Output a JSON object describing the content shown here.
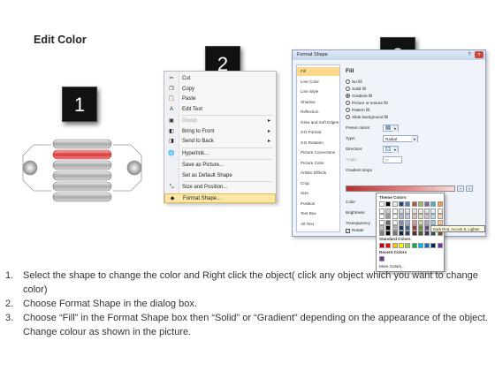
{
  "title": "Edit Color",
  "steps": [
    "1",
    "2",
    "3"
  ],
  "context_menu": {
    "items": [
      {
        "label": "Cut",
        "icon": "scissors-icon",
        "glyph": "✂",
        "disabled": false,
        "submenu": false,
        "highlight": false
      },
      {
        "label": "Copy",
        "icon": "copy-icon",
        "glyph": "❐",
        "disabled": false,
        "submenu": false,
        "highlight": false
      },
      {
        "label": "Paste",
        "icon": "paste-icon",
        "glyph": "📋",
        "disabled": false,
        "submenu": false,
        "highlight": false
      },
      {
        "label": "Edit Text",
        "icon": "edit-text-icon",
        "glyph": "A",
        "disabled": false,
        "submenu": false,
        "highlight": false
      },
      {
        "label": "Group",
        "icon": "group-icon",
        "glyph": "▣",
        "disabled": true,
        "submenu": true,
        "highlight": false
      },
      {
        "label": "Bring to Front",
        "icon": "bring-front-icon",
        "glyph": "◧",
        "disabled": false,
        "submenu": true,
        "highlight": false
      },
      {
        "label": "Send to Back",
        "icon": "send-back-icon",
        "glyph": "◨",
        "disabled": false,
        "submenu": true,
        "highlight": false
      },
      {
        "label": "Hyperlink...",
        "icon": "hyperlink-icon",
        "glyph": "🌐",
        "disabled": false,
        "submenu": false,
        "highlight": false
      },
      {
        "label": "Save as Picture...",
        "icon": "",
        "glyph": "",
        "disabled": false,
        "submenu": false,
        "highlight": false
      },
      {
        "label": "Set as Default Shape",
        "icon": "",
        "glyph": "",
        "disabled": false,
        "submenu": false,
        "highlight": false
      },
      {
        "label": "Size and Position...",
        "icon": "size-position-icon",
        "glyph": "⤡",
        "disabled": false,
        "submenu": false,
        "highlight": false
      },
      {
        "label": "Format Shape...",
        "icon": "format-shape-icon",
        "glyph": "◆",
        "disabled": false,
        "submenu": false,
        "highlight": true
      }
    ]
  },
  "dialog": {
    "title": "Format Shape",
    "title_buttons": [
      "?",
      "×"
    ],
    "nav": [
      "Fill",
      "Line Color",
      "Line Style",
      "Shadow",
      "Reflection",
      "Glow and Soft Edges",
      "3-D Format",
      "3-D Rotation",
      "Picture Corrections",
      "Picture Color",
      "Artistic Effects",
      "Crop",
      "Size",
      "Position",
      "Text Box",
      "Alt Text"
    ],
    "nav_selected": 0,
    "pane_heading": "Fill",
    "fill_options": [
      {
        "label": "No fill",
        "selected": false
      },
      {
        "label": "Solid fill",
        "selected": false
      },
      {
        "label": "Gradient fill",
        "selected": true
      },
      {
        "label": "Picture or texture fill",
        "selected": false
      },
      {
        "label": "Pattern fill",
        "selected": false
      },
      {
        "label": "Slide background fill",
        "selected": false
      }
    ],
    "preset_colors_label": "Preset colors:",
    "type_label": "Type:",
    "type_value": "Radial",
    "direction_label": "Direction:",
    "angle_label": "Angle:",
    "angle_value": "0°",
    "gradient_stops_label": "Gradient stops",
    "color_label": "Color",
    "position_label": "Position:",
    "position_value": "0%",
    "brightness_label": "Brightness",
    "transparency_label": "Transparency",
    "rotate_label": "Rotate"
  },
  "color_popup": {
    "theme_label": "Theme Colors",
    "standard_label": "Standard Colors",
    "recent_label": "Recent Colors",
    "more_label": "More Colors...",
    "tooltip": "Dark Red, Accent 5, Lighter",
    "theme_top": [
      "#ffffff",
      "#000000",
      "#eeece1",
      "#1f497d",
      "#4f81bd",
      "#c0504d",
      "#9bbb59",
      "#8064a2",
      "#4bacc6",
      "#f79646"
    ],
    "standard": [
      "#c00000",
      "#ff0000",
      "#ffc000",
      "#ffff00",
      "#92d050",
      "#00b050",
      "#00b0f0",
      "#0070c0",
      "#002060",
      "#7030a0"
    ],
    "recent": [
      "#7030a0"
    ]
  },
  "instructions": [
    {
      "num": "1.",
      "text": "Select the shape to change the color and Right click the object( click any object which you want to change color)"
    },
    {
      "num": "2.",
      "text": "Choose Format Shape in the dialog box."
    },
    {
      "num": "3.",
      "text": "Choose “Fill” in the Format Shape box then “Solid” or “Gradient” depending on the appearance of the object. Change colour as shown in the picture."
    }
  ],
  "colors": {
    "accent_red": "#d93b3b",
    "highlight": "#fbe7a6",
    "dialog_bg": "#f0f4fa"
  }
}
